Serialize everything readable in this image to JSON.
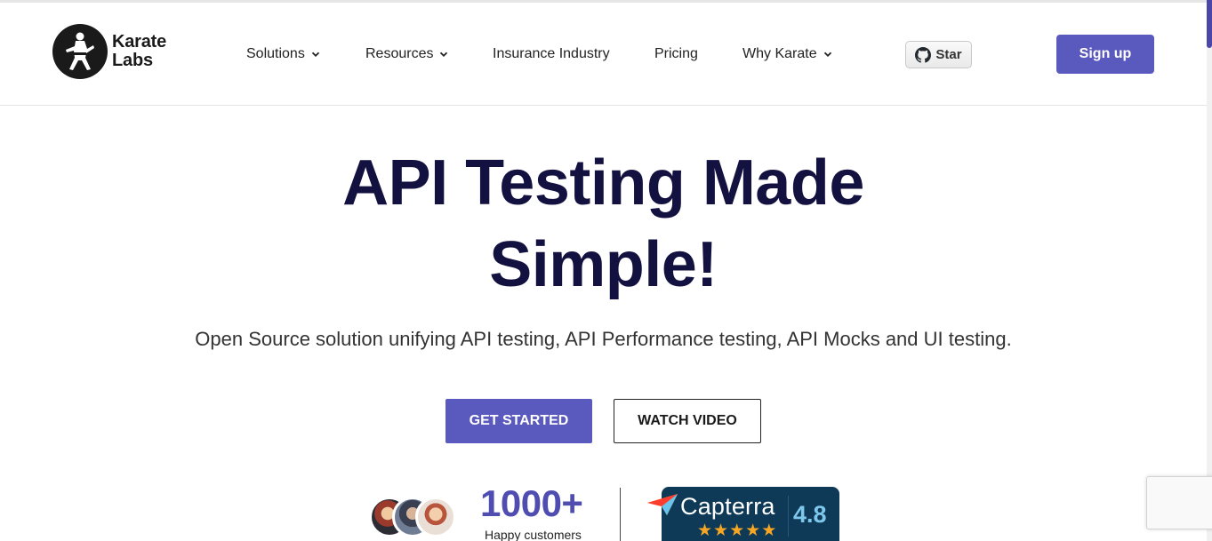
{
  "brand": {
    "name_line1": "Karate",
    "name_line2": "Labs"
  },
  "nav": {
    "items": [
      {
        "label": "Solutions",
        "has_dropdown": true
      },
      {
        "label": "Resources",
        "has_dropdown": true
      },
      {
        "label": "Insurance Industry",
        "has_dropdown": false
      },
      {
        "label": "Pricing",
        "has_dropdown": false
      },
      {
        "label": "Why Karate",
        "has_dropdown": true
      }
    ],
    "star_label": "Star",
    "signup_label": "Sign up"
  },
  "hero": {
    "title_line1": "API Testing Made",
    "title_line2": "Simple!",
    "subtitle": "Open Source solution unifying API testing, API Performance testing, API Mocks and UI testing.",
    "primary_cta": "GET STARTED",
    "secondary_cta": "WATCH VIDEO"
  },
  "social_proof": {
    "customers_count": "1000+",
    "customers_label": "Happy customers",
    "capterra_name": "Capterra",
    "capterra_rating": "4.8",
    "capterra_stars": 5
  },
  "colors": {
    "accent": "#5a59be",
    "title": "#131140",
    "capterra_bg": "#0e3a58",
    "star": "#f6a623"
  }
}
